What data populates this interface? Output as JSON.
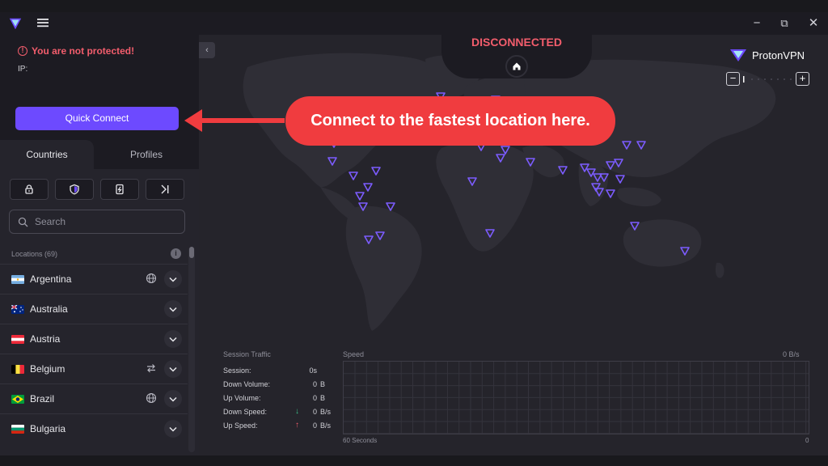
{
  "window": {
    "menu_icon": "hamburger-icon",
    "controls": {
      "minimize": "−",
      "restore": "⧉",
      "close": "✕"
    }
  },
  "status": {
    "warning": "You are not protected!",
    "ip_label": "IP:",
    "connection_state": "DISCONNECTED",
    "warning_color": "#f25d6c"
  },
  "quick_connect": {
    "label": "Quick Connect",
    "color": "#6d4aff"
  },
  "tabs": {
    "countries": "Countries",
    "profiles": "Profiles"
  },
  "filters": [
    "lock-icon",
    "shield-icon",
    "p2p-icon",
    "tor-icon"
  ],
  "search": {
    "placeholder": "Search"
  },
  "locations": {
    "header": "Locations (69)",
    "items": [
      {
        "name": "Argentina",
        "feature": "globe-icon"
      },
      {
        "name": "Australia",
        "feature": ""
      },
      {
        "name": "Austria",
        "feature": ""
      },
      {
        "name": "Belgium",
        "feature": "p2p-arrows-icon"
      },
      {
        "name": "Brazil",
        "feature": "globe-icon"
      },
      {
        "name": "Bulgaria",
        "feature": ""
      }
    ]
  },
  "brand": {
    "name": "ProtonVPN"
  },
  "zoom": {
    "minus": "−",
    "plus": "+"
  },
  "traffic": {
    "title": "Session Traffic",
    "rows": [
      {
        "label": "Session:",
        "arrow": "",
        "value": "0s",
        "unit": ""
      },
      {
        "label": "Down Volume:",
        "arrow": "",
        "value": "0",
        "unit": "B"
      },
      {
        "label": "Up Volume:",
        "arrow": "",
        "value": "0",
        "unit": "B"
      },
      {
        "label": "Down Speed:",
        "arrow": "↓",
        "value": "0",
        "unit": "B/s"
      },
      {
        "label": "Up Speed:",
        "arrow": "↑",
        "value": "0",
        "unit": "B/s"
      }
    ]
  },
  "speed_graph": {
    "label": "Speed",
    "max_label": "0 B/s",
    "x_left": "60 Seconds",
    "x_right": "0"
  },
  "annotation": {
    "text": "Connect to the fastest location here.",
    "color": "#f03c3f"
  }
}
